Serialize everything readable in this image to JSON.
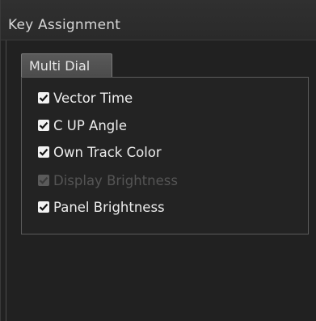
{
  "window": {
    "title": "Key Assignment"
  },
  "tabs": [
    {
      "label": "Multi Dial",
      "selected": true
    }
  ],
  "options": [
    {
      "label": "Vector Time",
      "checked": true,
      "enabled": true
    },
    {
      "label": "C UP Angle",
      "checked": true,
      "enabled": true
    },
    {
      "label": "Own Track Color",
      "checked": true,
      "enabled": true
    },
    {
      "label": "Display Brightness",
      "checked": true,
      "enabled": false
    },
    {
      "label": "Panel Brightness",
      "checked": true,
      "enabled": true
    }
  ],
  "colors": {
    "background": "#212121",
    "titlebar": "#2d2d2d",
    "tab": "#525252",
    "text": "#ececec",
    "disabled_text": "#555555",
    "checkbox": "#f2f2f2"
  },
  "icons": {
    "checkmark": "checkmark-icon"
  }
}
